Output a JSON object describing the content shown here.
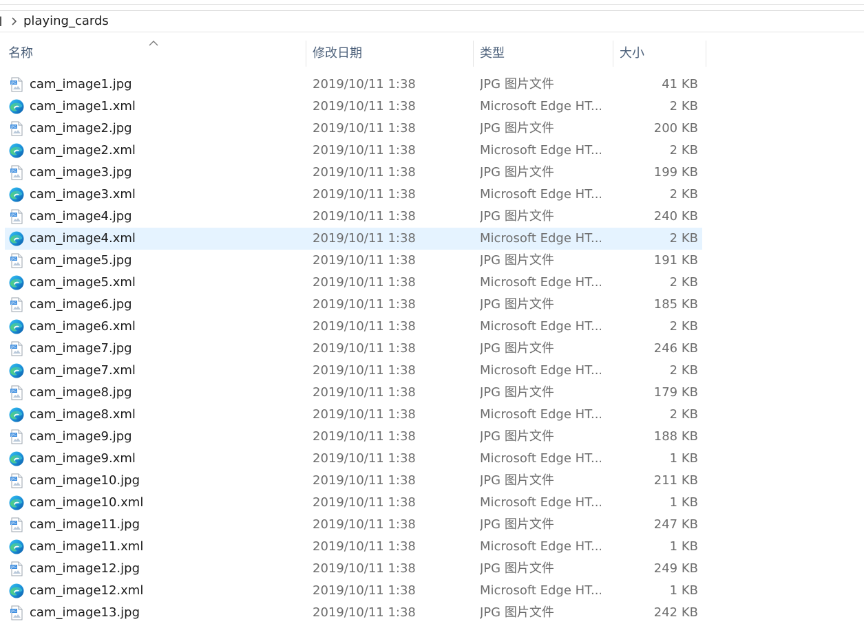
{
  "address": {
    "crumb": "playing_cards"
  },
  "columns": {
    "name": "名称",
    "date": "修改日期",
    "type": "类型",
    "size": "大小"
  },
  "icons": {
    "jpg": "jpg-file-icon",
    "xml": "edge-document-icon",
    "separator": "chevron-right-icon",
    "sort": "sort-up-icon"
  },
  "colors": {
    "selected_row": "#e5f3ff",
    "header_text": "#4c607a",
    "meta_text": "#6d6d6d"
  },
  "files": [
    {
      "name": "cam_image1.jpg",
      "date": "2019/10/11 1:38",
      "type": "JPG 图片文件",
      "size": "41 KB",
      "kind": "jpg",
      "selected": false
    },
    {
      "name": "cam_image1.xml",
      "date": "2019/10/11 1:38",
      "type": "Microsoft Edge HT...",
      "size": "2 KB",
      "kind": "xml",
      "selected": false
    },
    {
      "name": "cam_image2.jpg",
      "date": "2019/10/11 1:38",
      "type": "JPG 图片文件",
      "size": "200 KB",
      "kind": "jpg",
      "selected": false
    },
    {
      "name": "cam_image2.xml",
      "date": "2019/10/11 1:38",
      "type": "Microsoft Edge HT...",
      "size": "2 KB",
      "kind": "xml",
      "selected": false
    },
    {
      "name": "cam_image3.jpg",
      "date": "2019/10/11 1:38",
      "type": "JPG 图片文件",
      "size": "199 KB",
      "kind": "jpg",
      "selected": false
    },
    {
      "name": "cam_image3.xml",
      "date": "2019/10/11 1:38",
      "type": "Microsoft Edge HT...",
      "size": "2 KB",
      "kind": "xml",
      "selected": false
    },
    {
      "name": "cam_image4.jpg",
      "date": "2019/10/11 1:38",
      "type": "JPG 图片文件",
      "size": "240 KB",
      "kind": "jpg",
      "selected": false
    },
    {
      "name": "cam_image4.xml",
      "date": "2019/10/11 1:38",
      "type": "Microsoft Edge HT...",
      "size": "2 KB",
      "kind": "xml",
      "selected": true
    },
    {
      "name": "cam_image5.jpg",
      "date": "2019/10/11 1:38",
      "type": "JPG 图片文件",
      "size": "191 KB",
      "kind": "jpg",
      "selected": false
    },
    {
      "name": "cam_image5.xml",
      "date": "2019/10/11 1:38",
      "type": "Microsoft Edge HT...",
      "size": "2 KB",
      "kind": "xml",
      "selected": false
    },
    {
      "name": "cam_image6.jpg",
      "date": "2019/10/11 1:38",
      "type": "JPG 图片文件",
      "size": "185 KB",
      "kind": "jpg",
      "selected": false
    },
    {
      "name": "cam_image6.xml",
      "date": "2019/10/11 1:38",
      "type": "Microsoft Edge HT...",
      "size": "2 KB",
      "kind": "xml",
      "selected": false
    },
    {
      "name": "cam_image7.jpg",
      "date": "2019/10/11 1:38",
      "type": "JPG 图片文件",
      "size": "246 KB",
      "kind": "jpg",
      "selected": false
    },
    {
      "name": "cam_image7.xml",
      "date": "2019/10/11 1:38",
      "type": "Microsoft Edge HT...",
      "size": "2 KB",
      "kind": "xml",
      "selected": false
    },
    {
      "name": "cam_image8.jpg",
      "date": "2019/10/11 1:38",
      "type": "JPG 图片文件",
      "size": "179 KB",
      "kind": "jpg",
      "selected": false
    },
    {
      "name": "cam_image8.xml",
      "date": "2019/10/11 1:38",
      "type": "Microsoft Edge HT...",
      "size": "2 KB",
      "kind": "xml",
      "selected": false
    },
    {
      "name": "cam_image9.jpg",
      "date": "2019/10/11 1:38",
      "type": "JPG 图片文件",
      "size": "188 KB",
      "kind": "jpg",
      "selected": false
    },
    {
      "name": "cam_image9.xml",
      "date": "2019/10/11 1:38",
      "type": "Microsoft Edge HT...",
      "size": "1 KB",
      "kind": "xml",
      "selected": false
    },
    {
      "name": "cam_image10.jpg",
      "date": "2019/10/11 1:38",
      "type": "JPG 图片文件",
      "size": "211 KB",
      "kind": "jpg",
      "selected": false
    },
    {
      "name": "cam_image10.xml",
      "date": "2019/10/11 1:38",
      "type": "Microsoft Edge HT...",
      "size": "1 KB",
      "kind": "xml",
      "selected": false
    },
    {
      "name": "cam_image11.jpg",
      "date": "2019/10/11 1:38",
      "type": "JPG 图片文件",
      "size": "247 KB",
      "kind": "jpg",
      "selected": false
    },
    {
      "name": "cam_image11.xml",
      "date": "2019/10/11 1:38",
      "type": "Microsoft Edge HT...",
      "size": "1 KB",
      "kind": "xml",
      "selected": false
    },
    {
      "name": "cam_image12.jpg",
      "date": "2019/10/11 1:38",
      "type": "JPG 图片文件",
      "size": "249 KB",
      "kind": "jpg",
      "selected": false
    },
    {
      "name": "cam_image12.xml",
      "date": "2019/10/11 1:38",
      "type": "Microsoft Edge HT...",
      "size": "1 KB",
      "kind": "xml",
      "selected": false
    },
    {
      "name": "cam_image13.jpg",
      "date": "2019/10/11 1:38",
      "type": "JPG 图片文件",
      "size": "242 KB",
      "kind": "jpg",
      "selected": false
    }
  ]
}
